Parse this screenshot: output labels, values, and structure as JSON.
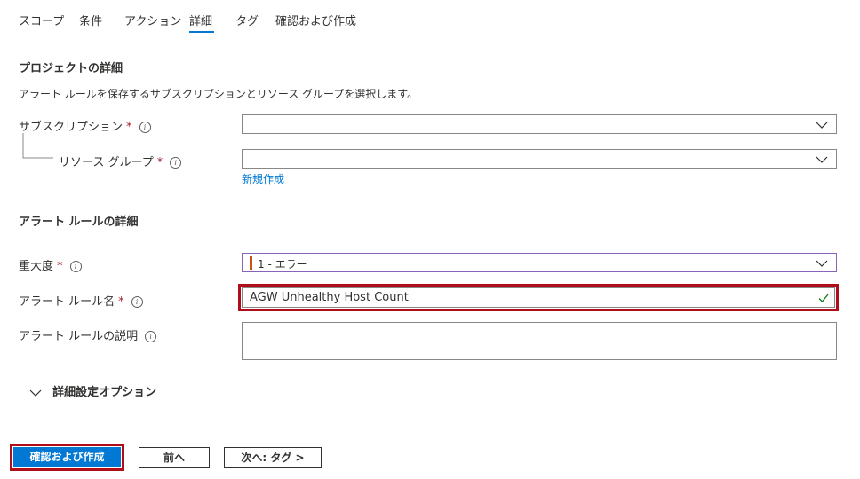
{
  "tabs": [
    {
      "label": "スコープ"
    },
    {
      "label": "条件"
    },
    {
      "label": "アクション"
    },
    {
      "label": "詳細"
    },
    {
      "label": "タグ"
    },
    {
      "label": "確認および作成"
    }
  ],
  "active_tab": "詳細",
  "project": {
    "title": "プロジェクトの詳細",
    "description": "アラート ルールを保存するサブスクリプションとリソース グループを選択します。",
    "subscription_label": "サブスクリプション",
    "subscription_value": "",
    "resource_group_label": "リソース グループ",
    "resource_group_value": "",
    "create_new_link": "新規作成"
  },
  "rule": {
    "title": "アラート ルールの詳細",
    "severity_label": "重大度",
    "severity_value": "1 - エラー",
    "name_label": "アラート ルール名",
    "name_value": "AGW Unhealthy Host Count",
    "description_label": "アラート ルールの説明",
    "description_value": ""
  },
  "advanced": {
    "label": "詳細設定オプション"
  },
  "footer": {
    "review_create": "確認および作成",
    "previous": "前へ",
    "next": "次へ: タグ >"
  },
  "required_marker": "*",
  "colors": {
    "accent": "#0078d4",
    "required": "#a4262c",
    "highlight": "#b00d1b",
    "severity_bar": "#ca5010",
    "valid_check": "#107c10"
  }
}
